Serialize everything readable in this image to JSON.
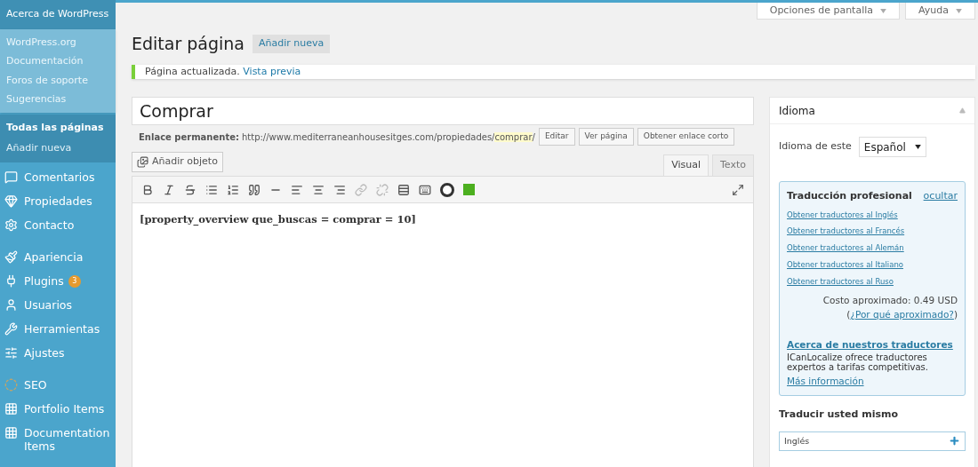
{
  "sidebar": {
    "flyout": {
      "title": "Acerca de WordPress",
      "links": [
        "WordPress.org",
        "Documentación",
        "Foros de soporte",
        "Sugerencias"
      ]
    },
    "submenu": [
      {
        "label": "Todas las páginas",
        "selected": true
      },
      {
        "label": "Añadir nueva",
        "selected": false
      }
    ],
    "menu": [
      {
        "label": "Comentarios"
      },
      {
        "label": "Propiedades"
      },
      {
        "label": "Contacto"
      },
      {
        "label": "Apariencia"
      },
      {
        "label": "Plugins",
        "badge": "3"
      },
      {
        "label": "Usuarios"
      },
      {
        "label": "Herramientas"
      },
      {
        "label": "Ajustes"
      },
      {
        "label": "SEO"
      },
      {
        "label": "Portfolio Items"
      },
      {
        "label": "Documentation Items"
      }
    ]
  },
  "top_buttons": [
    "Opciones de pantalla",
    "Ayuda"
  ],
  "page": {
    "title": "Editar página",
    "add_new": "Añadir nueva"
  },
  "notice": {
    "text": "Página actualizada.",
    "link": "Vista previa"
  },
  "editor": {
    "title_value": "Comprar",
    "permalink": {
      "label": "Enlace permanente:",
      "url": "http://www.mediterraneanhousesitges.com/propiedades/",
      "slug": "comprar",
      "trail": "/",
      "buttons": [
        "Editar",
        "Ver página",
        "Obtener enlace corto"
      ]
    },
    "add_media": "Añadir objeto",
    "tabs": [
      {
        "label": "Visual",
        "selected": true
      },
      {
        "label": "Texto",
        "selected": false
      }
    ],
    "content": "[property_overview que_buscas = comprar = 10]"
  },
  "language_box": {
    "title": "Idioma",
    "label": "Idioma de este",
    "select_value": "Español",
    "pro": {
      "title": "Traducción profesional",
      "hide": "ocultar",
      "links": [
        "Obtener traductores al Inglés",
        "Obtener traductores al Francés",
        "Obtener traductores al Alemán",
        "Obtener traductores al Italiano",
        "Obtener traductores al Ruso"
      ],
      "cost": "Costo aproximado: 0.49 USD",
      "why_open": "(",
      "why": "¿Por qué aproximado?",
      "why_close": ")",
      "about": "Acerca de nuestros traductores",
      "desc": "ICanLocalize ofrece traductores expertos a tarifas competitivas.",
      "more": "Más información"
    },
    "self_title": "Traducir usted mismo",
    "self_items": [
      "Inglés"
    ]
  }
}
